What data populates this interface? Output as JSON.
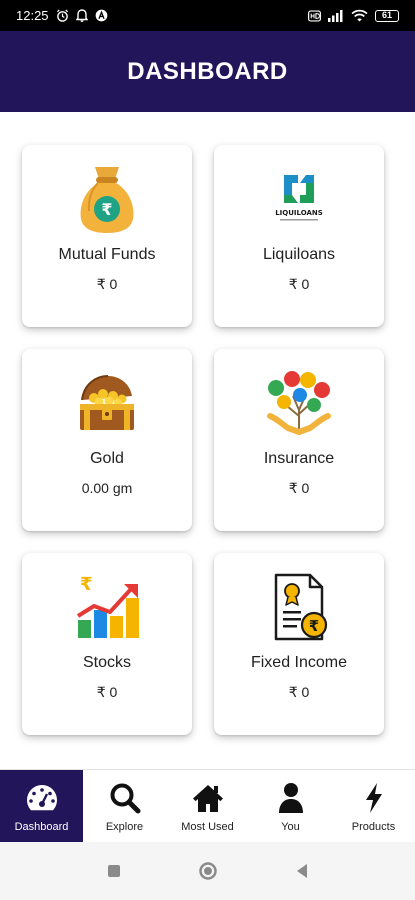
{
  "status_bar": {
    "time": "12:25",
    "battery": "61"
  },
  "header": {
    "title": "DASHBOARD"
  },
  "cards": [
    {
      "title": "Mutual Funds",
      "value": "₹ 0",
      "icon": "money-bag-icon"
    },
    {
      "title": "Liquiloans",
      "value": "₹ 0",
      "icon": "liquiloans-logo",
      "logo_text": "LIQUILOANS"
    },
    {
      "title": "Gold",
      "value": "0.00 gm",
      "icon": "treasure-chest-icon"
    },
    {
      "title": "Insurance",
      "value": "₹ 0",
      "icon": "insurance-hands-icon"
    },
    {
      "title": "Stocks",
      "value": "₹ 0",
      "icon": "stocks-chart-icon"
    },
    {
      "title": "Fixed Income",
      "value": "₹ 0",
      "icon": "certificate-icon"
    }
  ],
  "bottom_nav": {
    "active": "Dashboard",
    "items": [
      {
        "label": "Dashboard",
        "icon": "speedometer-icon"
      },
      {
        "label": "Explore",
        "icon": "search-icon"
      },
      {
        "label": "Most Used",
        "icon": "home-icon"
      },
      {
        "label": "You",
        "icon": "user-icon"
      },
      {
        "label": "Products",
        "icon": "bolt-icon"
      }
    ]
  },
  "colors": {
    "primary": "#231559",
    "card_bg": "#ffffff",
    "text": "#212121"
  }
}
